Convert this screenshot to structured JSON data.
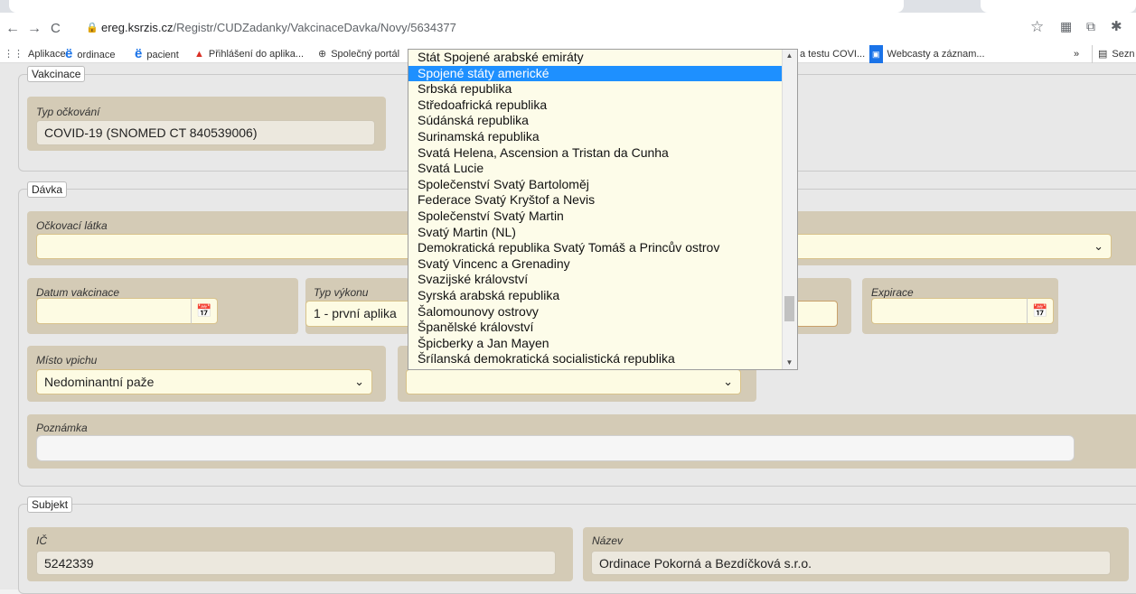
{
  "browser": {
    "url_domain": "ereg.ksrzis.cz",
    "url_path": "/Registr/CUDZadanky/VakcinaceDavka/Novy/5634377",
    "back_icon": "←",
    "forward_icon": "→",
    "reload_icon": "C",
    "lock_icon": "🔒",
    "star_icon": "☆",
    "ext_icon_1": "▦",
    "ext_icon_2": "⧉",
    "ext_icon_3": "✱",
    "bookmarks": [
      {
        "label": "Aplikace",
        "icon": "⋮⋮"
      },
      {
        "label": "ordinace",
        "icon": "ë"
      },
      {
        "label": "pacient",
        "icon": "ë"
      },
      {
        "label": "Přihlášení do aplika...",
        "icon": "▲"
      },
      {
        "label": "Společný portál",
        "icon": "⊕"
      },
      {
        "label": "a testu COVI...",
        "icon": ""
      },
      {
        "label": "Webcasty a záznam...",
        "icon": "▣"
      }
    ],
    "more_bookmarks": "»",
    "reading_list": "Sezn"
  },
  "sections": {
    "vakcinace": {
      "legend": "Vakcinace",
      "typ_ockovani_label": "Typ očkování",
      "typ_ockovani_value": "COVID-19 (SNOMED CT 840539006)"
    },
    "davka": {
      "legend": "Dávka",
      "ockovaci_latka_label": "Očkovací látka",
      "ockovaci_latka_value": "",
      "datum_label": "Datum vakcinace",
      "datum_value": "",
      "typ_vykonu_label": "Typ výkonu",
      "typ_vykonu_value": "1 - první aplika",
      "expirace_label": "Expirace",
      "expirace_value": "",
      "misto_label": "Místo vpichu",
      "misto_value": "Nedominantní paže",
      "country_value": "",
      "poznamka_label": "Poznámka",
      "poznamka_value": ""
    },
    "subjekt": {
      "legend": "Subjekt",
      "ic_label": "IČ",
      "ic_value": "5242339",
      "nazev_label": "Název",
      "nazev_value": "Ordinace Pokorná a Bezdíčková s.r.o."
    }
  },
  "icons": {
    "calendar_icon": "📅",
    "chevron": "⌄",
    "scroll_up": "▲",
    "scroll_down": "▼"
  },
  "dropdown": {
    "options": [
      "Stát Spojené arabské emiráty",
      "Spojené státy americké",
      "Srbská republika",
      "Středoafrická republika",
      "Súdánská republika",
      "Surinamská republika",
      "Svatá Helena, Ascension a Tristan da Cunha",
      "Svatá Lucie",
      "Společenství Svatý Bartoloměj",
      "Federace Svatý Kryštof a Nevis",
      "Společenství Svatý Martin",
      "Svatý Martin (NL)",
      "Demokratická republika Svatý Tomáš a Princův ostrov",
      "Svatý Vincenc a Grenadiny",
      "Svazijské království",
      "Syrská arabská republika",
      "Šalomounovy ostrovy",
      "Španělské království",
      "Špicberky a Jan Mayen",
      "Šrílanská demokratická socialistická republika"
    ],
    "selected_index": 1
  }
}
